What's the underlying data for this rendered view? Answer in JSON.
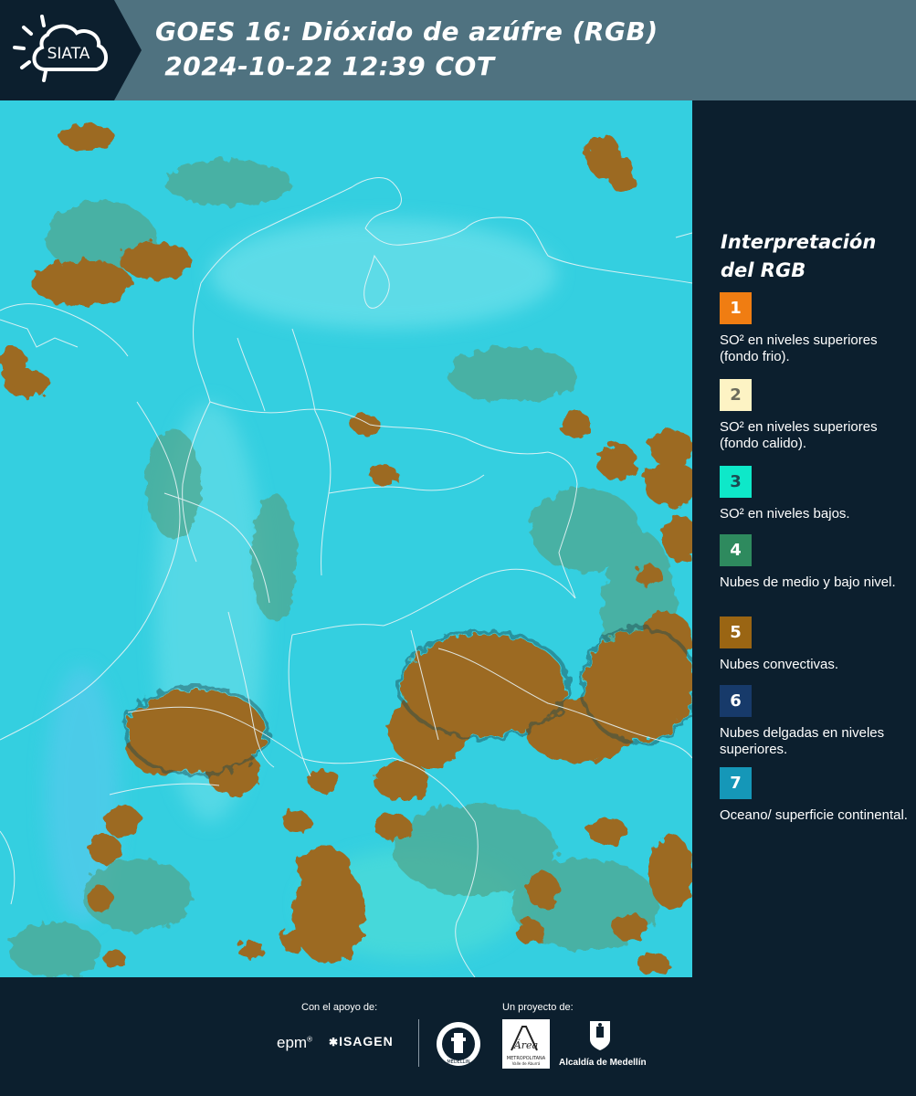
{
  "header": {
    "logo_text": "SIATA",
    "title_line1": "GOES 16: Dióxido de azúfre (RGB)",
    "title_line2": " 2024-10-22 12:39 COT"
  },
  "legend": {
    "title": "Interpretación del RGB",
    "items": [
      {
        "number": "1",
        "text": "SO² en niveles superiores (fondo frio).",
        "color": "#f07d12",
        "num_color": "#ffffff"
      },
      {
        "number": "2",
        "text": "SO² en niveles superiores (fondo calido).",
        "color": "#fdf3c4",
        "num_color": "#6b6b5c"
      },
      {
        "number": "3",
        "text": "SO² en niveles bajos.",
        "color": "#0ee8c9",
        "num_color": "#1c4a52"
      },
      {
        "number": "4",
        "text": "Nubes de medio y bajo nivel.",
        "color": "#2e8a5e",
        "num_color": "#ffffff"
      },
      {
        "number": "5",
        "text": "Nubes convectivas.",
        "color": "#9a6513",
        "num_color": "#ffffff"
      },
      {
        "number": "6",
        "text": "Nubes delgadas en niveles superiores.",
        "color": "#173a6a",
        "num_color": "#ffffff"
      },
      {
        "number": "7",
        "text": "Oceano/ superficie continental.",
        "color": "#1597b8",
        "num_color": "#ffffff"
      }
    ]
  },
  "footer": {
    "support_label": "Con el apoyo de:",
    "project_label": "Un proyecto de:",
    "sponsor_1": "epm",
    "sponsor_2": "ISAGEN",
    "partner_3": "Alcaldía de Medellín",
    "logo_lettering": [
      "MEDELLIN",
      "Área",
      "METROPOLITANA",
      "Valle de Aburrá"
    ]
  },
  "map": {
    "background_color": "#34cfe0",
    "cloud_color": "#9c6b22",
    "border_color": "#e8f4f6"
  }
}
